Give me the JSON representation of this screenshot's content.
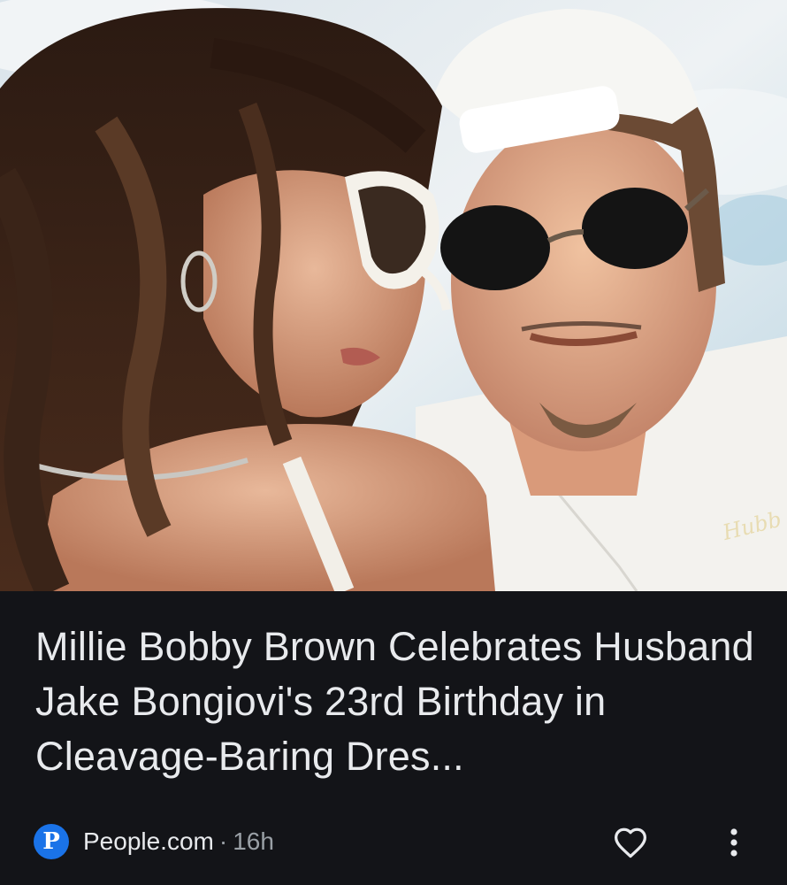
{
  "article": {
    "title": "Millie Bobby Brown Celebrates Husband Jake Bongiovi's 23rd Birthday in Cleavage-Baring Dres...",
    "image_alt": "photo of couple wearing sunglasses",
    "watermark": "Hubb"
  },
  "source": {
    "logo_letter": "P",
    "name": "People.com",
    "separator": "·",
    "age": "16h"
  },
  "icons": {
    "like": "heart-outline-icon",
    "more": "more-vert-icon"
  },
  "colors": {
    "background": "#131418",
    "title_text": "#e8eaed",
    "meta_text": "#9aa0a6",
    "publisher_logo": "#1a73e8"
  }
}
